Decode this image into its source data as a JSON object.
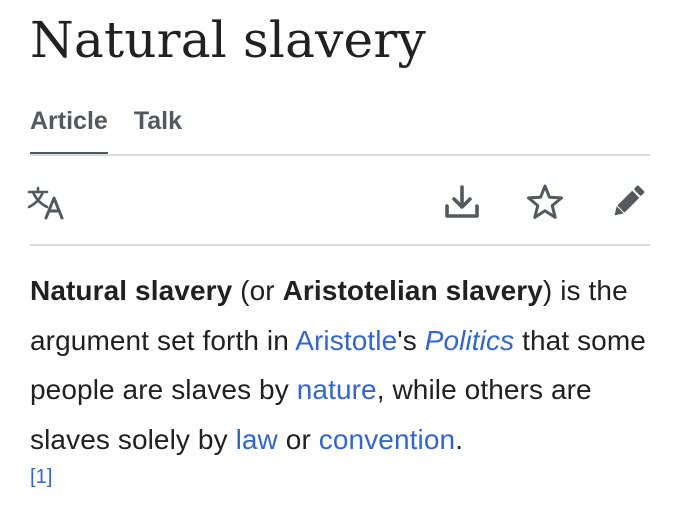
{
  "page": {
    "title": "Natural slavery"
  },
  "tabs": [
    {
      "label": "Article",
      "active": true
    },
    {
      "label": "Talk",
      "active": false
    }
  ],
  "toolbar": {
    "language_icon": "translate-icon",
    "download_icon": "download-icon",
    "watch_icon": "star-icon",
    "edit_icon": "pencil-icon"
  },
  "content": {
    "bold1": "Natural slavery",
    "t1": " (or ",
    "bold2": "Aristotelian slavery",
    "t2": ") is the argument set forth in ",
    "link_aristotle": "Aristotle",
    "t3": "'s ",
    "link_politics": "Politics",
    "t4": " that some people are slaves by ",
    "link_nature": "nature",
    "t5": ", while others are slaves solely by ",
    "link_law": "law",
    "t6": " or ",
    "link_convention": "convention",
    "t7": ".",
    "citation": "[1]"
  },
  "colors": {
    "text": "#202122",
    "link": "#3366cc",
    "tab_text": "#54595d",
    "icon": "#54595d",
    "divider": "#dcdde0"
  }
}
